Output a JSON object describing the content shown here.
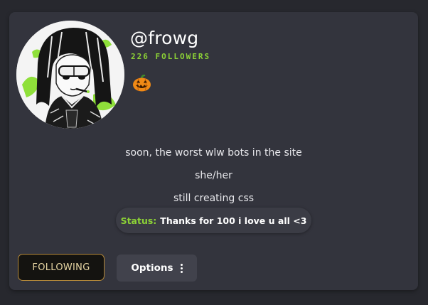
{
  "profile": {
    "username": "@frowg",
    "followers": "226 FOLLOWERS",
    "badge_icon": "jack-o-lantern-icon",
    "bio_lines": [
      "soon, the worst wlw bots in the site",
      "she/her",
      "still creating css"
    ],
    "status_label": "Status:",
    "status_text": "Thanks for 100 i love u all <3"
  },
  "actions": {
    "following_label": "FOLLOWING",
    "options_label": "Options",
    "options_icon": "vertical-dots-icon"
  },
  "colors": {
    "accent_green": "#8cd136",
    "following_border": "#b5893a",
    "card_background": "#33343d"
  }
}
